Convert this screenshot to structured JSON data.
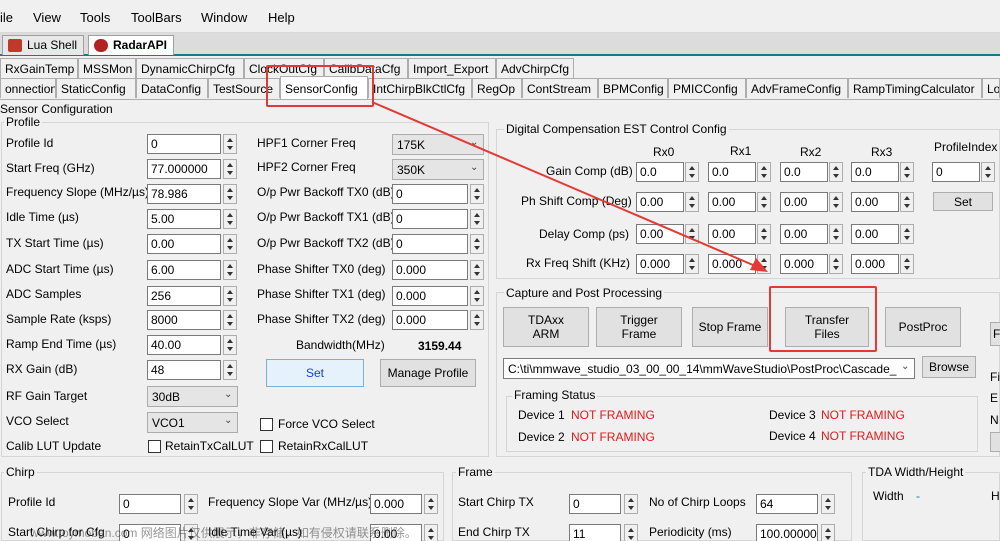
{
  "menu": [
    "ile",
    "View",
    "Tools",
    "ToolBars",
    "Window",
    "Help"
  ],
  "doc_tabs": [
    "Lua Shell",
    "RadarAPI"
  ],
  "tabs_row1": [
    "RxGainTemp",
    "MSSMon",
    "DynamicChirpCfg",
    "ClockOutCfg",
    "CalibDataCfg",
    "Import_Export",
    "AdvChirpCfg"
  ],
  "tabs_row2": [
    "onnection",
    "StaticConfig",
    "DataConfig",
    "TestSource",
    "SensorConfig",
    "IntChirpBlkCtlCfg",
    "RegOp",
    "ContStream",
    "BPMConfig",
    "PMICConfig",
    "AdvFrameConfig",
    "RampTimingCalculator",
    "Lo"
  ],
  "sensor_config_title": "Sensor Configuration",
  "profile": {
    "title": "Profile",
    "left": [
      {
        "label": "Profile Id",
        "value": "0"
      },
      {
        "label": "Start Freq (GHz)",
        "value": "77.000000"
      },
      {
        "label": "Frequency Slope (MHz/µs)",
        "value": "78.986"
      },
      {
        "label": "Idle Time (µs)",
        "value": "5.00"
      },
      {
        "label": "TX Start Time (µs)",
        "value": "0.00"
      },
      {
        "label": "ADC Start Time (µs)",
        "value": "6.00"
      },
      {
        "label": "ADC Samples",
        "value": "256"
      },
      {
        "label": "Sample Rate (ksps)",
        "value": "8000"
      },
      {
        "label": "Ramp End Time (µs)",
        "value": "40.00"
      },
      {
        "label": "RX Gain (dB)",
        "value": "48"
      }
    ],
    "rf_gain_target": {
      "label": "RF Gain Target",
      "value": "30dB"
    },
    "vco_select": {
      "label": "VCO Select",
      "value": "VCO1"
    },
    "calib_lut_update": "Calib LUT Update",
    "retain_tx": "RetainTxCalLUT",
    "retain_rx": "RetainRxCalLUT",
    "hpf1": {
      "label": "HPF1 Corner Freq",
      "value": "175K"
    },
    "hpf2": {
      "label": "HPF2 Corner Freq",
      "value": "350K"
    },
    "mid": [
      {
        "label": "O/p Pwr Backoff TX0 (dB)",
        "value": "0"
      },
      {
        "label": "O/p Pwr Backoff TX1 (dB)",
        "value": "0"
      },
      {
        "label": "O/p Pwr Backoff TX2 (dB)",
        "value": "0"
      },
      {
        "label": "Phase Shifter TX0 (deg)",
        "value": "0.000"
      },
      {
        "label": "Phase Shifter TX1 (deg)",
        "value": "0.000"
      },
      {
        "label": "Phase Shifter TX2 (deg)",
        "value": "0.000"
      }
    ],
    "bandwidth_label": "Bandwidth(MHz)",
    "bandwidth_value": "3159.44",
    "set_label": "Set",
    "manage_label": "Manage Profile",
    "force_vco": "Force VCO Select"
  },
  "dcomp": {
    "title": "Digital Compensation EST Control Config",
    "headers": [
      "Rx0",
      "Rx1",
      "Rx2",
      "Rx3"
    ],
    "profile_index_label": "ProfileIndex",
    "profile_index_value": "0",
    "set_label": "Set",
    "rows": [
      {
        "label": "Gain Comp (dB)",
        "values": [
          "0.0",
          "0.0",
          "0.0",
          "0.0"
        ]
      },
      {
        "label": "Ph Shift Comp (Deg)",
        "values": [
          "0.00",
          "0.00",
          "0.00",
          "0.00"
        ]
      },
      {
        "label": "Delay Comp (ps)",
        "values": [
          "0.00",
          "0.00",
          "0.00",
          "0.00"
        ]
      },
      {
        "label": "Rx Freq Shift (KHz)",
        "values": [
          "0.000",
          "0.000",
          "0.000",
          "0.000"
        ]
      }
    ]
  },
  "capture": {
    "title": "Capture and Post Processing",
    "tdaxx_arm": "TDAxx\nARM",
    "trigger_frame": "Trigger\nFrame",
    "stop_frame": "Stop Frame",
    "transfer_files": "Transfer\nFiles",
    "postproc": "PostProc",
    "path": "C:\\ti\\mmwave_studio_03_00_00_14\\mmWaveStudio\\PostProc\\Cascade_",
    "browse": "Browse",
    "framing_title": "Framing Status",
    "devices": [
      {
        "label": "Device 1",
        "status": "NOT FRAMING"
      },
      {
        "label": "Device 2",
        "status": "NOT FRAMING"
      },
      {
        "label": "Device 3",
        "status": "NOT FRAMING"
      },
      {
        "label": "Device 4",
        "status": "NOT FRAMING"
      }
    ],
    "side_letters": [
      "F",
      "Fi",
      "E",
      "N"
    ]
  },
  "chirp": {
    "title": "Chirp",
    "profile_id_label": "Profile Id",
    "profile_id_value": "0",
    "start_chirp_label": "Start Chirp for Cfg",
    "start_chirp_value": "0",
    "slope_var_label": "Frequency Slope Var (MHz/µs)",
    "slope_var_value": "0.000",
    "idle_var_label": "Idle Time Var (µs)",
    "idle_var_value": "0.00"
  },
  "frame": {
    "title": "Frame",
    "start_chirp_label": "Start Chirp TX",
    "start_chirp_value": "0",
    "end_chirp_label": "End Chirp TX",
    "end_chirp_value": "11",
    "num_loops_label": "No of Chirp Loops",
    "num_loops_value": "64",
    "periodicity_label": "Periodicity (ms)",
    "periodicity_value": "100.000000"
  },
  "tda": {
    "title": "TDA Width/Height",
    "width_label": "Width",
    "width_value": "-",
    "h": "H"
  },
  "watermark": "www.toymoban.com 网络图片仅供展示，非存储，如有侵权请联系删除。",
  "colors": {
    "accent": "#0f7d8a",
    "highlight": "#e53935",
    "status": "#e01b1b"
  }
}
